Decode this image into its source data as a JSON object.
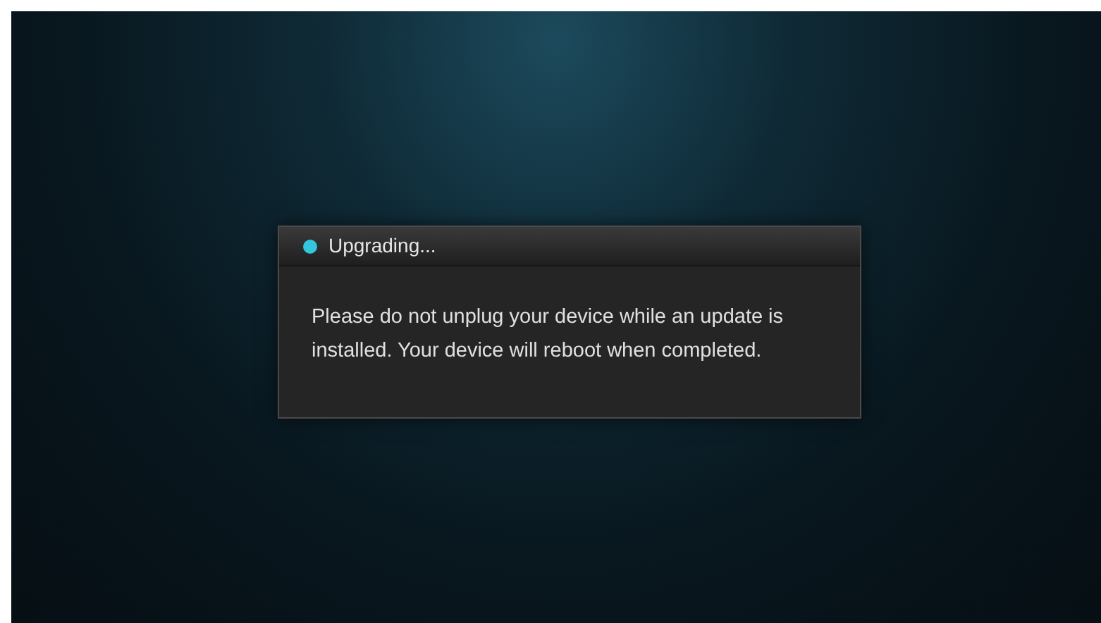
{
  "dialog": {
    "title": "Upgrading...",
    "message": "Please do not unplug your device while an update is installed. Your device will reboot when completed."
  }
}
